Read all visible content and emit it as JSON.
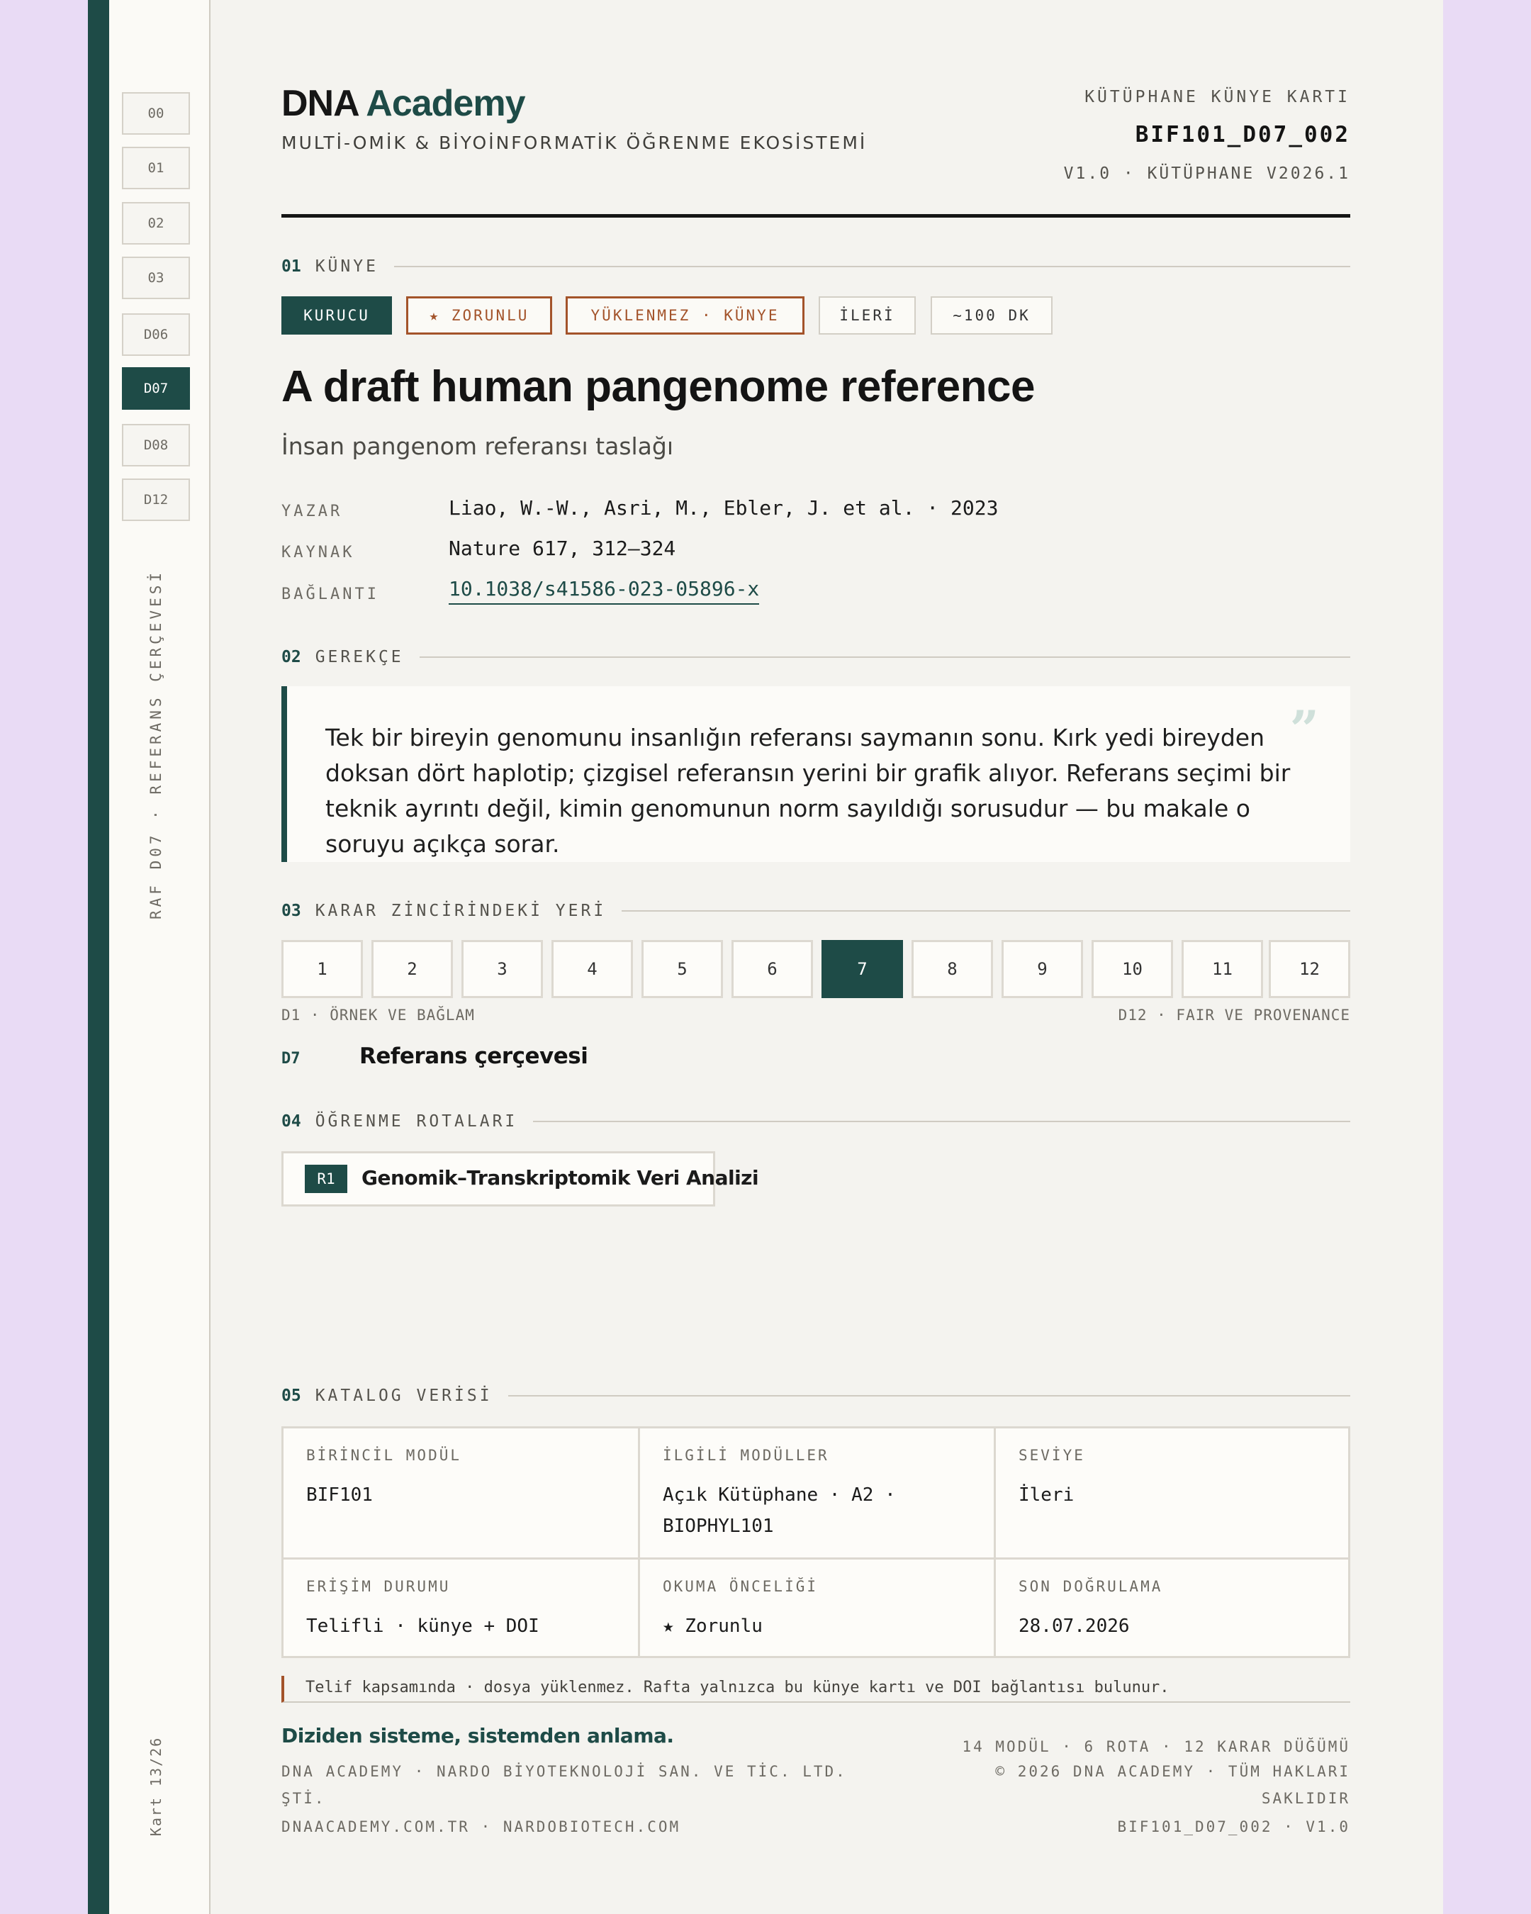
{
  "spine": {
    "tabs": [
      "00",
      "01",
      "02",
      "03",
      "D06",
      "D07",
      "D08",
      "D12"
    ],
    "active_tab": "D07",
    "shelf_label": "RAF D07 · REFERANS ÇERÇEVESİ",
    "card_counter": "Kart 13/26"
  },
  "header": {
    "brand_dna": "DNA",
    "brand_academy": "Academy",
    "tagline": "MULTİ-OMİK & BİYOİNFORMATİK ÖĞRENME EKOSİSTEMİ",
    "card_type": "KÜTÜPHANE KÜNYE KARTI",
    "card_code": "BIF101_D07_002",
    "version": "V1.0 · KÜTÜPHANE V2026.1"
  },
  "sections": {
    "s1": {
      "num": "01",
      "label": "KÜNYE"
    },
    "s2": {
      "num": "02",
      "label": "GEREKÇE"
    },
    "s3": {
      "num": "03",
      "label": "KARAR ZİNCİRİNDEKİ YERİ"
    },
    "s4": {
      "num": "04",
      "label": "ÖĞRENME ROTALARI"
    },
    "s5": {
      "num": "05",
      "label": "KATALOG VERİSİ"
    }
  },
  "tags": [
    "KURUCU",
    "★ ZORUNLU",
    "YÜKLENMEZ · KÜNYE",
    "İLERİ",
    "~100 DK"
  ],
  "paper": {
    "title": "A draft human pangenome reference",
    "subtitle": "İnsan pangenom referansı taslağı",
    "author_label": "YAZAR",
    "author": "Liao, W.-W., Asri, M., Ebler, J. et al. · 2023",
    "source_label": "KAYNAK",
    "source": "Nature 617, 312–324",
    "link_label": "BAĞLANTI",
    "link": "10.1038/s41586-023-05896-x"
  },
  "rationale": {
    "quote_mark": "”",
    "text": "Tek bir bireyin genomunu insanlığın referansı saymanın sonu. Kırk yedi bireyden doksan dört haplotip; çizgisel referansın yerini bir grafik alıyor. Referans seçimi bir teknik ayrıntı değil, kimin genomunun norm sayıldığı sorusudur — bu makale o soruyu açıkça sorar."
  },
  "chain": {
    "steps": [
      "1",
      "2",
      "3",
      "4",
      "5",
      "6",
      "7",
      "8",
      "9",
      "10",
      "11",
      "12"
    ],
    "active_step": "7",
    "start_caption": "D1 · ÖRNEK VE BAĞLAM",
    "end_caption": "D12 · FAIR VE PROVENANCE",
    "current_code": "D7",
    "current_label": "Referans çerçevesi"
  },
  "routes": [
    {
      "badge": "R1",
      "label": "Genomik–Transkriptomik Veri Analizi"
    }
  ],
  "catalog": {
    "primary_label": "BİRİNCİL MODÜL",
    "primary": "BIF101",
    "related_label": "İLGİLİ MODÜLLER",
    "related": "Açık Kütüphane · A2 · BIOPHYL101",
    "level_label": "SEVİYE",
    "level": "İleri",
    "access_label": "ERİŞİM DURUMU",
    "access": "Telifli · künye + DOI",
    "priority_label": "OKUMA ÖNCELİĞİ",
    "priority": "★ Zorunlu",
    "verified_label": "SON DOĞRULAMA",
    "verified": "28.07.2026"
  },
  "note": "Telif kapsamında · dosya yüklenmez. Rafta yalnızca bu künye kartı ve DOI bağlantısı bulunur.",
  "footer": {
    "slogan": "Diziden sisteme, sistemden anlama.",
    "company": "DNA ACADEMY · NARDO BİYOTEKNOLOJİ SAN. VE TİC. LTD. ŞTİ.",
    "sites": "DNAACADEMY.COM.TR · NARDOBIOTECH.COM",
    "stats": "14 MODÜL · 6 ROTA · 12 KARAR DÜĞÜMÜ",
    "copyright": "© 2026 DNA ACADEMY · TÜM HAKLARI SAKLIDIR",
    "code": "BIF101_D07_002 · V1.0"
  },
  "colors": {
    "accent": "#1e4b47",
    "rust": "#a3532a",
    "page_bg": "#e9dbf5",
    "card_bg": "#f4f3ef"
  }
}
